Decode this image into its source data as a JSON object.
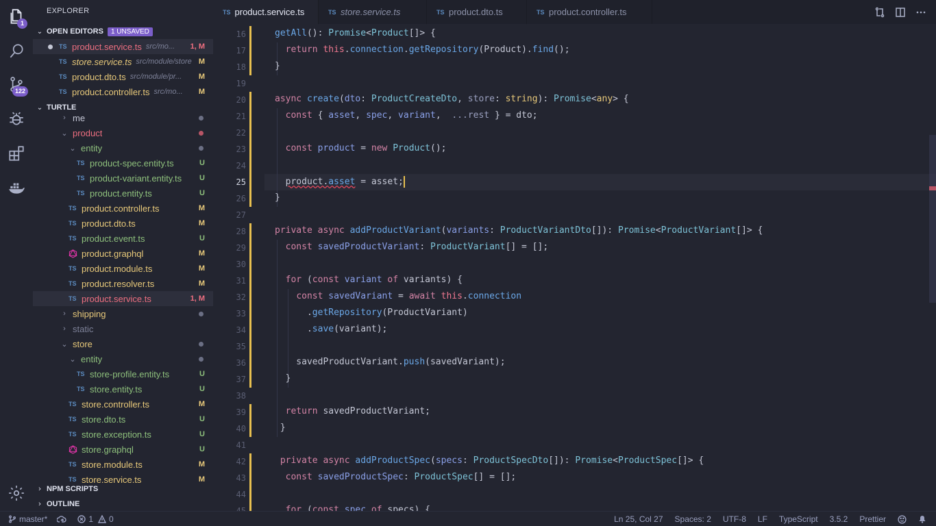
{
  "activity_bar": {
    "explorer_badge": "1",
    "scm_badge": "122",
    "icons": [
      "files-icon",
      "search-icon",
      "source-control-icon",
      "debug-icon",
      "extensions-icon",
      "docker-icon",
      "gear-icon"
    ]
  },
  "sidebar": {
    "title": "EXPLORER",
    "open_editors": {
      "label": "OPEN EDITORS",
      "badge": "1 UNSAVED",
      "items": [
        {
          "name": "product.service.ts",
          "path": "src/mo...",
          "status": "1, M"
        },
        {
          "name": "store.service.ts",
          "path": "src/module/store",
          "status": "M"
        },
        {
          "name": "product.dto.ts",
          "path": "src/module/pr...",
          "status": "M"
        },
        {
          "name": "product.controller.ts",
          "path": "src/mo...",
          "status": "M"
        }
      ]
    },
    "project": {
      "label": "TURTLE",
      "items": [
        {
          "name": "me",
          "kind": "folder",
          "open": false,
          "status": ""
        },
        {
          "name": "product",
          "kind": "folder",
          "open": true,
          "status": ""
        },
        {
          "name": "entity",
          "kind": "folder",
          "open": true,
          "status": ""
        },
        {
          "name": "product-spec.entity.ts",
          "kind": "ts",
          "status": "U"
        },
        {
          "name": "product-variant.entity.ts",
          "kind": "ts",
          "status": "U"
        },
        {
          "name": "product.entity.ts",
          "kind": "ts",
          "status": "U"
        },
        {
          "name": "product.controller.ts",
          "kind": "ts",
          "status": "M"
        },
        {
          "name": "product.dto.ts",
          "kind": "ts",
          "status": "M"
        },
        {
          "name": "product.event.ts",
          "kind": "ts",
          "status": "U"
        },
        {
          "name": "product.graphql",
          "kind": "graphql",
          "status": "M"
        },
        {
          "name": "product.module.ts",
          "kind": "ts",
          "status": "M"
        },
        {
          "name": "product.resolver.ts",
          "kind": "ts",
          "status": "M"
        },
        {
          "name": "product.service.ts",
          "kind": "ts",
          "status": "1, M"
        },
        {
          "name": "shipping",
          "kind": "folder",
          "open": false,
          "status": ""
        },
        {
          "name": "static",
          "kind": "folder",
          "open": false,
          "status": ""
        },
        {
          "name": "store",
          "kind": "folder",
          "open": true,
          "status": ""
        },
        {
          "name": "entity",
          "kind": "folder",
          "open": true,
          "status": ""
        },
        {
          "name": "store-profile.entity.ts",
          "kind": "ts",
          "status": "U"
        },
        {
          "name": "store.entity.ts",
          "kind": "ts",
          "status": "U"
        },
        {
          "name": "store.controller.ts",
          "kind": "ts",
          "status": "M"
        },
        {
          "name": "store.dto.ts",
          "kind": "ts",
          "status": "U"
        },
        {
          "name": "store.exception.ts",
          "kind": "ts",
          "status": "U"
        },
        {
          "name": "store.graphql",
          "kind": "graphql",
          "status": "U"
        },
        {
          "name": "store.module.ts",
          "kind": "ts",
          "status": "M"
        },
        {
          "name": "store.service.ts",
          "kind": "ts",
          "status": "M"
        }
      ]
    },
    "npm_scripts": "NPM SCRIPTS",
    "outline": "OUTLINE"
  },
  "tabs": [
    {
      "label": "product.service.ts",
      "active": true,
      "modified": true
    },
    {
      "label": "store.service.ts",
      "active": false,
      "italic": true
    },
    {
      "label": "product.dto.ts",
      "active": false
    },
    {
      "label": "product.controller.ts",
      "active": false
    }
  ],
  "editor": {
    "current_line": "25",
    "line_numbers": [
      "16",
      "17",
      "18",
      "19",
      "20",
      "21",
      "22",
      "23",
      "24",
      "25",
      "26",
      "27",
      "28",
      "29",
      "30",
      "31",
      "32",
      "33",
      "34",
      "35",
      "36",
      "37",
      "38",
      "39",
      "40",
      "41",
      "42",
      "43",
      "44",
      "45"
    ]
  },
  "status_bar": {
    "branch": "master*",
    "errors": "1",
    "warnings": "0",
    "position": "Ln 25, Col 27",
    "spaces": "Spaces: 2",
    "encoding": "UTF-8",
    "eol": "LF",
    "language": "TypeScript",
    "version": "3.5.2",
    "formatter": "Prettier"
  }
}
